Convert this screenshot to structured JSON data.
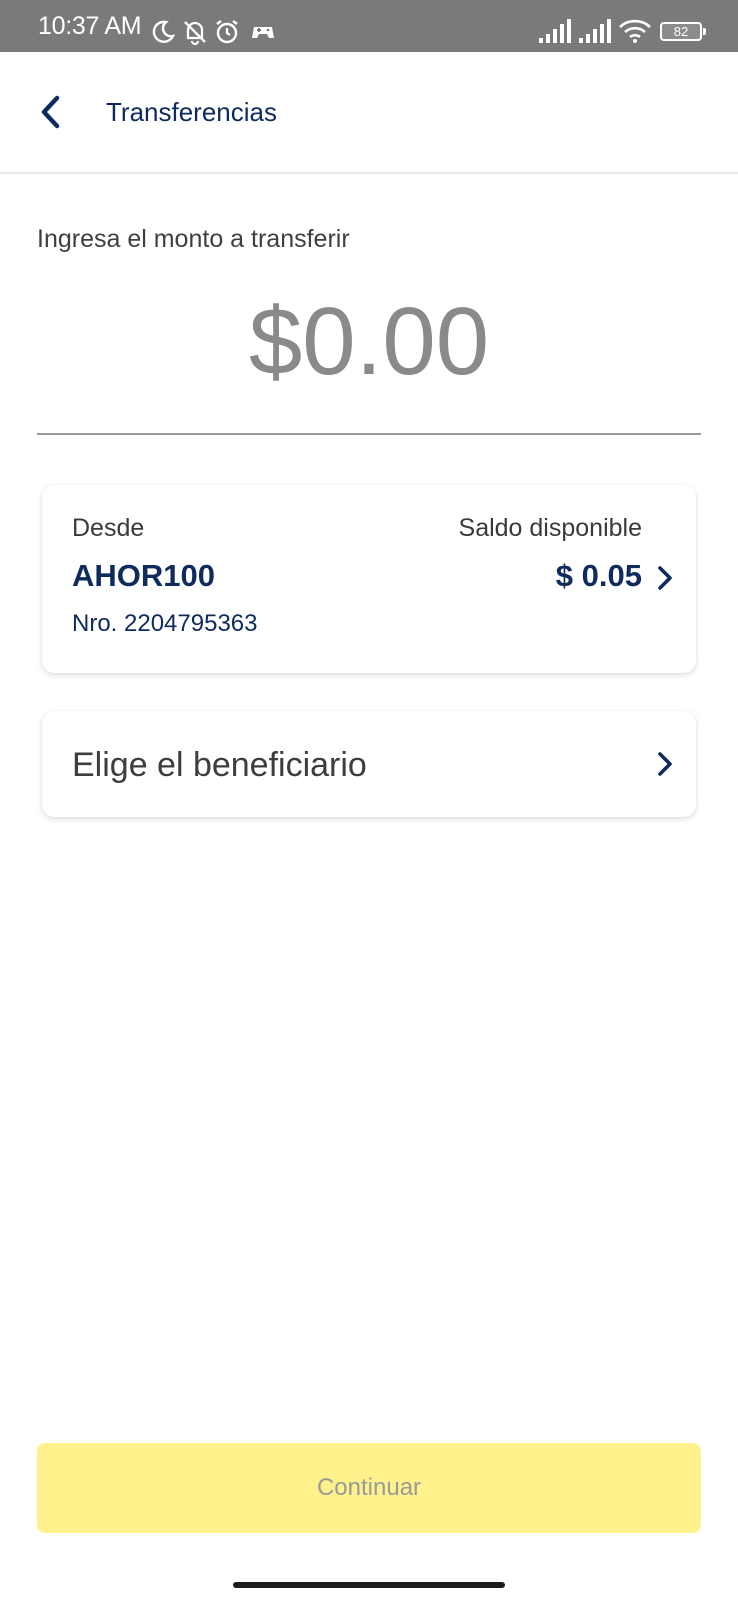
{
  "status_bar": {
    "time": "10:37 AM",
    "battery": "82",
    "icons": [
      "moon-icon",
      "bell-off-icon",
      "alarm-icon",
      "game-controller-icon",
      "signal-icon",
      "signal-icon",
      "wifi-icon",
      "battery-icon"
    ]
  },
  "header": {
    "title": "Transferencias",
    "back_icon": "chevron-left-icon"
  },
  "amount": {
    "label": "Ingresa el monto a transferir",
    "value": "$0.00"
  },
  "account": {
    "from_label": "Desde",
    "name": "AHOR100",
    "number": "Nro. 2204795363",
    "balance_label": "Saldo disponible",
    "balance_value": "$ 0.05"
  },
  "beneficiary": {
    "label": "Elige el beneficiario"
  },
  "actions": {
    "continue_label": "Continuar",
    "continue_enabled": false
  },
  "colors": {
    "primary_navy": "#0f2a5c",
    "button_disabled_bg": "#fff28c",
    "button_disabled_text": "#9a9a9a",
    "status_bar_bg": "#7a7a7a"
  }
}
